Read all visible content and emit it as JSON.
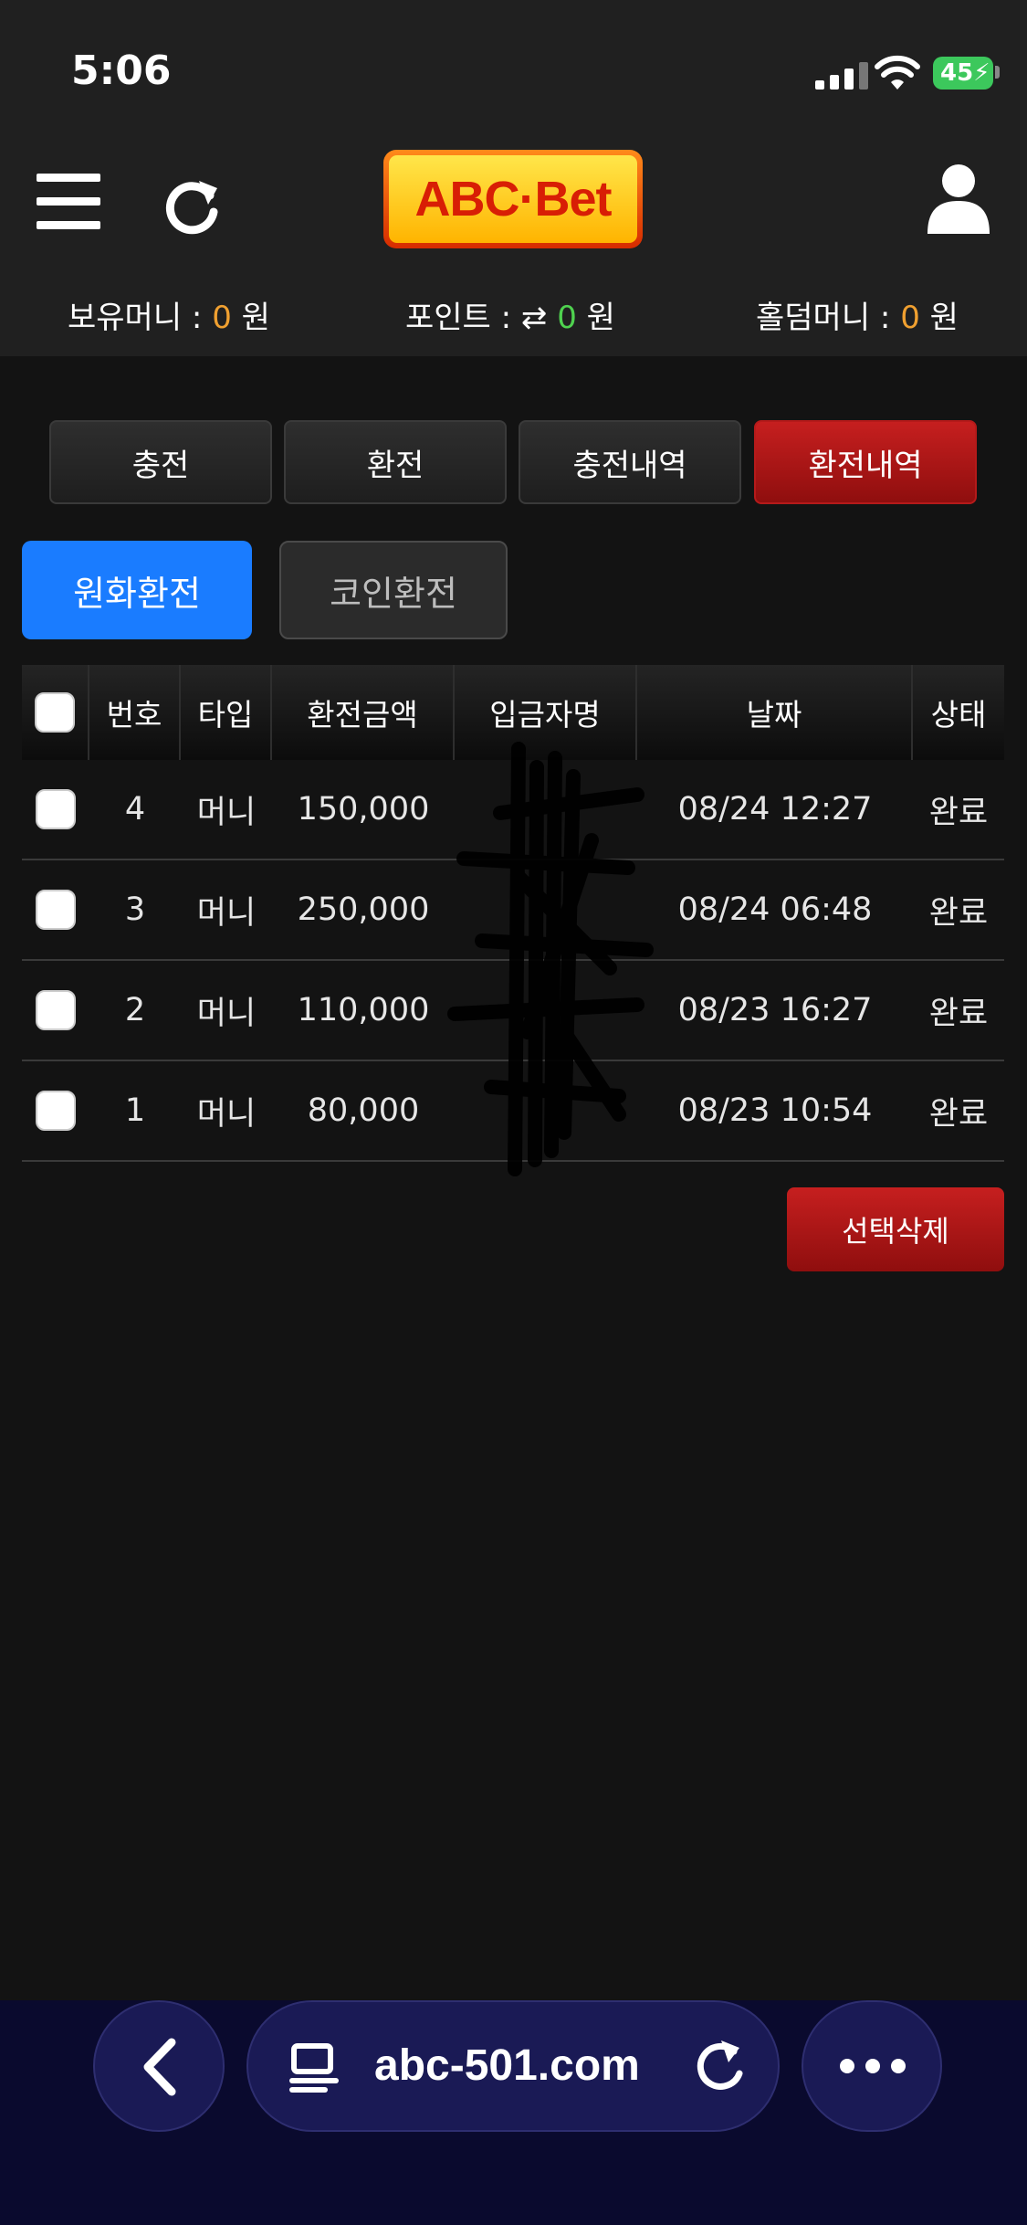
{
  "status_bar": {
    "time": "5:06",
    "battery": "45"
  },
  "header": {
    "logo_text": "ABC·Bet",
    "balances": [
      {
        "label": "보유머니 : ",
        "value": "0",
        "unit": " 원"
      },
      {
        "label": "포인트 : ",
        "value": "0",
        "unit": " 원"
      },
      {
        "label": "홀덤머니 : ",
        "value": "0",
        "unit": " 원"
      }
    ]
  },
  "tabs": [
    {
      "label": "충전",
      "active": false
    },
    {
      "label": "환전",
      "active": false
    },
    {
      "label": "충전내역",
      "active": false
    },
    {
      "label": "환전내역",
      "active": true
    }
  ],
  "subtabs": [
    {
      "label": "원화환전",
      "active": true
    },
    {
      "label": "코인환전",
      "active": false
    }
  ],
  "table": {
    "headers": [
      "번호",
      "타입",
      "환전금액",
      "입금자명",
      "날짜",
      "상태"
    ],
    "rows": [
      {
        "num": "4",
        "type": "머니",
        "amount": "150,000",
        "name": "",
        "date": "08/24 12:27",
        "status": "완료"
      },
      {
        "num": "3",
        "type": "머니",
        "amount": "250,000",
        "name": "",
        "date": "08/24 06:48",
        "status": "완료"
      },
      {
        "num": "2",
        "type": "머니",
        "amount": "110,000",
        "name": "",
        "date": "08/23 16:27",
        "status": "완료"
      },
      {
        "num": "1",
        "type": "머니",
        "amount": "80,000",
        "name": "",
        "date": "08/23 10:54",
        "status": "완료"
      }
    ]
  },
  "actions": {
    "delete_label": "선택삭제"
  },
  "browser": {
    "url": "abc-501.com"
  },
  "colors": {
    "accent_red": "#b51a1a",
    "accent_blue": "#1a7cff",
    "value_orange": "#f0a030",
    "value_green": "#4fd24f"
  }
}
